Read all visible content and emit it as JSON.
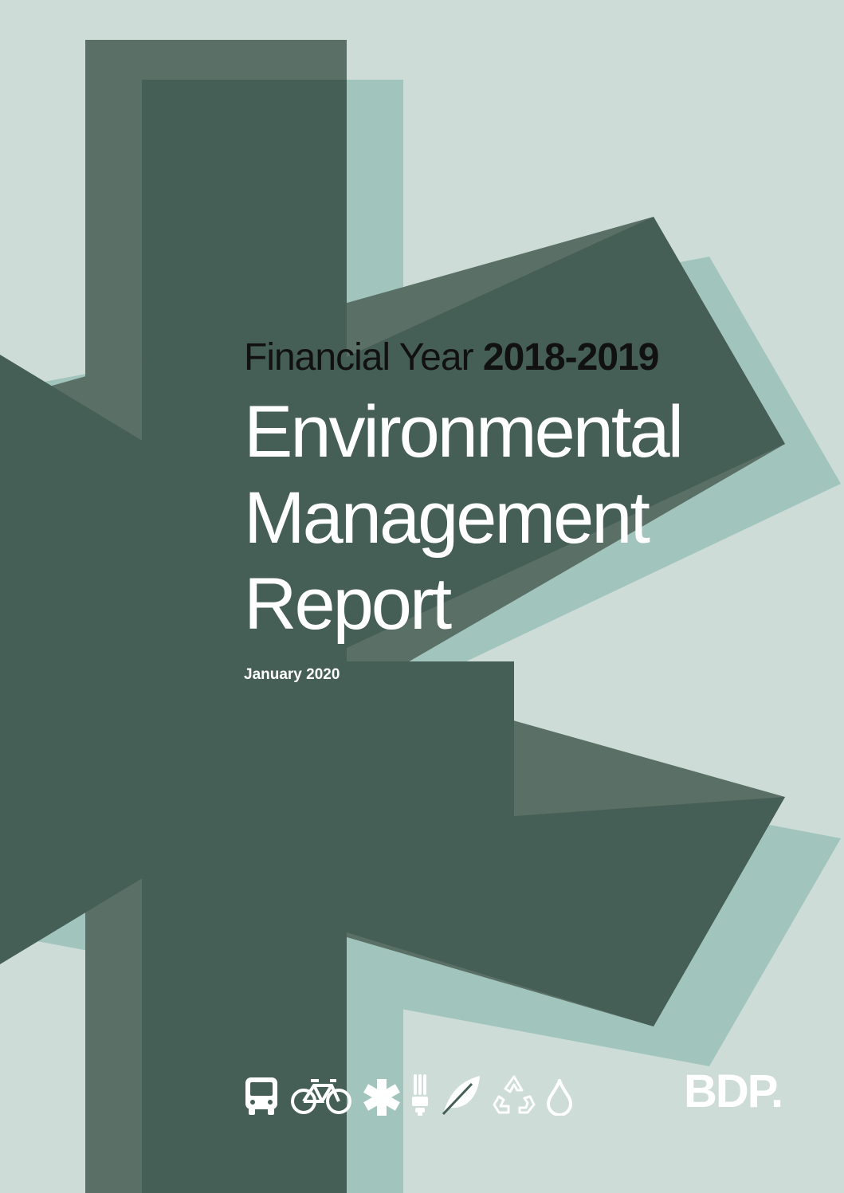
{
  "cover": {
    "financial_year_prefix": "Financial Year",
    "financial_year_value": "2018-2019",
    "title_line_1": "Environmental",
    "title_line_2": "Management",
    "title_line_3": "Report",
    "date": "January 2020",
    "logo_text": "BDP."
  },
  "icons": [
    "bus-icon",
    "bicycle-icon",
    "asterisk-icon",
    "lightbulb-icon",
    "leaf-icon",
    "recycle-icon",
    "water-drop-icon"
  ],
  "colors": {
    "background": "#cddcd6",
    "asterisk_dark": "#465f56",
    "asterisk_mid": "#5a6f65",
    "asterisk_shadow": "#a1c4bd",
    "text_white": "#ffffff",
    "text_dark": "#111111"
  }
}
